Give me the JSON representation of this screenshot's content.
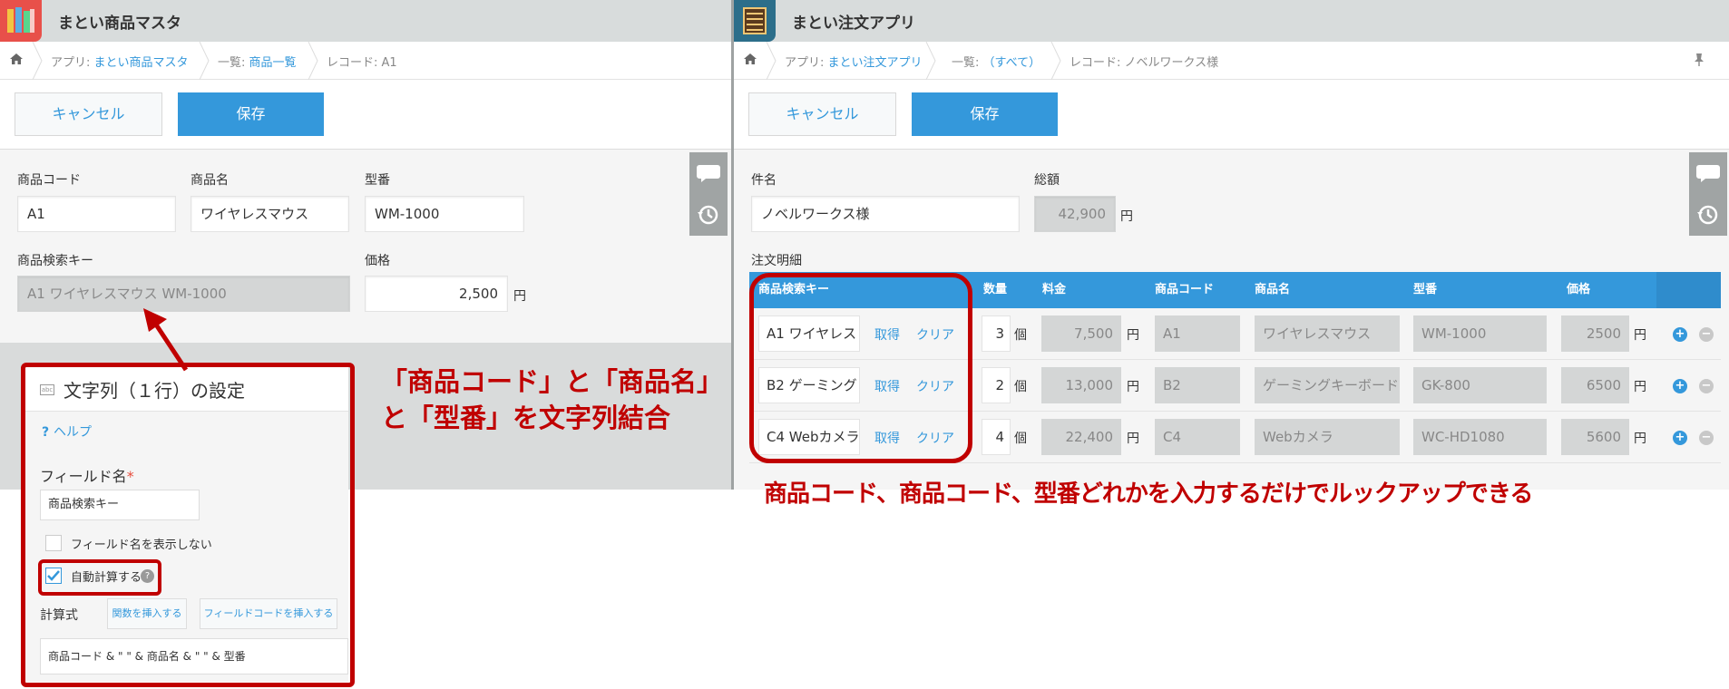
{
  "left": {
    "app_title": "まとい商品マスタ",
    "breadcrumb": {
      "app_prefix": "アプリ:",
      "app_name": "まとい商品マスタ",
      "list_prefix": "一覧:",
      "list_name": "商品一覧",
      "record": "レコード: A1"
    },
    "cancel_label": "キャンセル",
    "save_label": "保存",
    "fields": {
      "code_label": "商品コード",
      "code_value": "A1",
      "name_label": "商品名",
      "name_value": "ワイヤレスマウス",
      "model_label": "型番",
      "model_value": "WM-1000",
      "searchkey_label": "商品検索キー",
      "searchkey_value": "A1 ワイヤレスマウス WM-1000",
      "price_label": "価格",
      "price_value": "2,500",
      "price_unit": "円"
    }
  },
  "settings": {
    "title": "文字列（１行）の設定",
    "help": "ヘルプ",
    "field_name_label": "フィールド名",
    "required_mark": "*",
    "field_name_value": "商品検索キー",
    "hide_label": "フィールド名を表示しない",
    "hide_checked": false,
    "auto_calc_label": "自動計算する",
    "auto_calc_checked": true,
    "formula_label": "計算式",
    "insert_func": "関数を挿入する",
    "insert_field": "フィールドコードを挿入する",
    "formula_value": "商品コード & \" \" & 商品名 & \" \" & 型番"
  },
  "right": {
    "app_title": "まとい注文アプリ",
    "breadcrumb": {
      "app_prefix": "アプリ:",
      "app_name": "まとい注文アプリ",
      "list_prefix": "一覧:",
      "list_name": "（すべて）",
      "record": "レコード: ノベルワークス様"
    },
    "cancel_label": "キャンセル",
    "save_label": "保存",
    "subject_label": "件名",
    "subject_value": "ノベルワークス様",
    "total_label": "総額",
    "total_value": "42,900",
    "total_unit": "円",
    "table_label": "注文明細",
    "table_headers": [
      "商品検索キー",
      "数量",
      "料金",
      "商品コード",
      "商品名",
      "型番",
      "価格"
    ],
    "get_label": "取得",
    "clear_label": "クリア",
    "qty_unit": "個",
    "yen_unit": "円",
    "rows": [
      {
        "key": "A1 ワイヤレス",
        "qty": "3",
        "fee": "7,500",
        "code": "A1",
        "name": "ワイヤレスマウス",
        "model": "WM-1000",
        "price": "2500"
      },
      {
        "key": "B2 ゲーミング",
        "qty": "2",
        "fee": "13,000",
        "code": "B2",
        "name": "ゲーミングキーボード",
        "model": "GK-800",
        "price": "6500"
      },
      {
        "key": "C4 Webカメラ",
        "qty": "4",
        "fee": "22,400",
        "code": "C4",
        "name": "Webカメラ",
        "model": "WC-HD1080",
        "price": "5600"
      }
    ]
  },
  "annotations": {
    "concat_line1": "「商品コード」と「商品名」",
    "concat_line2": "と「型番」を文字列結合",
    "lookup_note": "商品コード、商品コード、型番どれかを入力するだけでルックアップできる"
  },
  "colors": {
    "accent": "#3498db",
    "annotation": "#c00000",
    "table_header": "#3498db"
  }
}
